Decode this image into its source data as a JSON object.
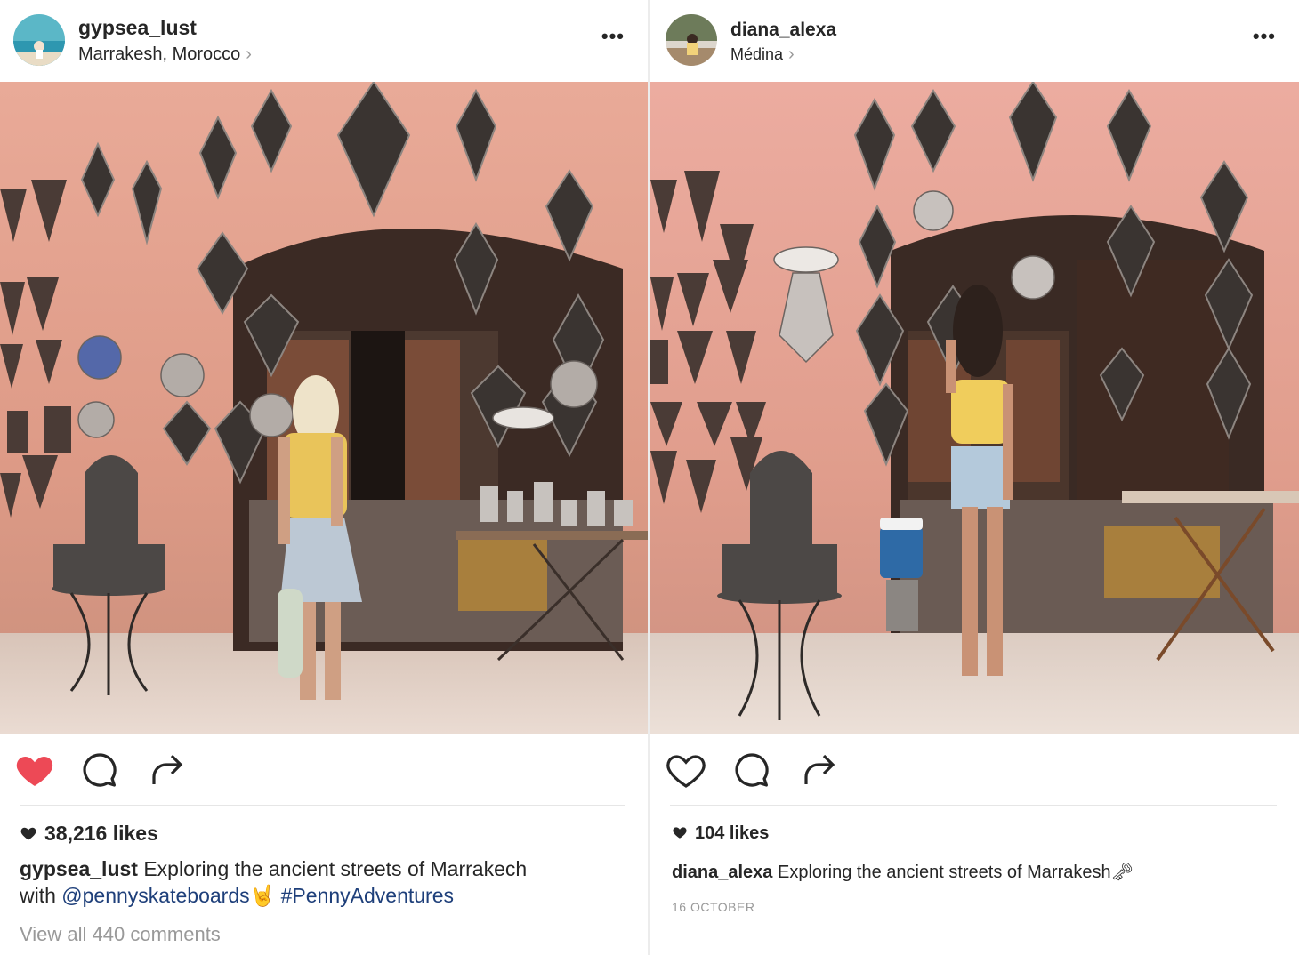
{
  "posts": [
    {
      "username": "gypsea_lust",
      "location": "Marrakesh, Morocco",
      "more_label": "•••",
      "liked": true,
      "likes": "38,216 likes",
      "caption": {
        "user": "gypsea_lust",
        "text_1": "Exploring the ancient streets of Marrakech",
        "text_2": "with",
        "mention": "@pennyskateboards",
        "emoji": "🤘",
        "hashtag": "#PennyAdventures"
      },
      "comments": "View all 440 comments"
    },
    {
      "username": "diana_alexa",
      "location": "Médina",
      "more_label": "•••",
      "liked": false,
      "likes": "104 likes",
      "caption": {
        "user": "diana_alexa",
        "text_1": "Exploring the ancient streets of Marrakesh",
        "emoji": "🗝"
      },
      "date": "16 OCTOBER"
    }
  ],
  "icons": {
    "like": "heart-icon",
    "comment": "comment-bubble-icon",
    "share": "share-arrow-icon",
    "more": "more-dots-icon",
    "chevron": "chevron-right-icon"
  },
  "colors": {
    "liked_heart": "#ed4956",
    "link": "#1e3f7a",
    "muted": "#999999",
    "text": "#262626"
  }
}
